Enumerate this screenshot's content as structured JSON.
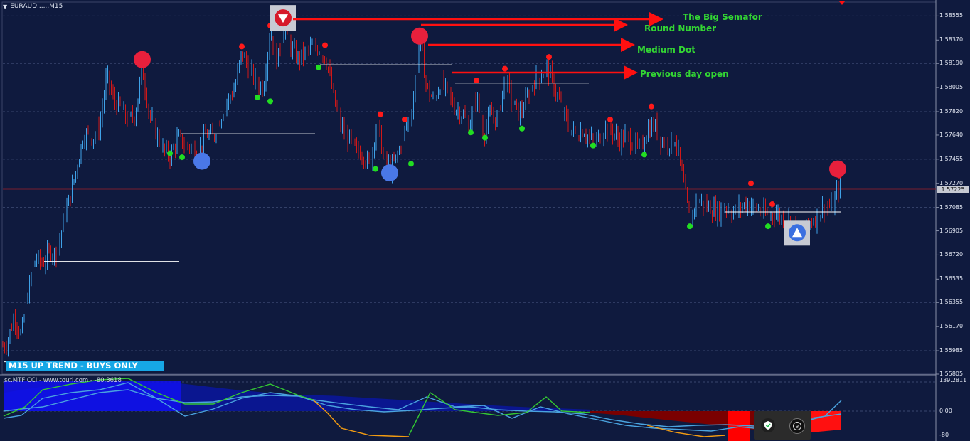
{
  "window": {
    "title": "EURAUD.....,M15"
  },
  "trend_badge": "M15 UP TREND - BUYS ONLY",
  "indicator": {
    "title": "sc.MTF CCI - www.tourl.com - -80.3618",
    "axis_top": "139.2811",
    "axis_mid": "0.00",
    "axis_bottom": "-80"
  },
  "annotations": {
    "big_semafor": "The Big Semafor",
    "round_number": "Round Number",
    "medium_dot": "Medium Dot",
    "previous_day_open": "Previous day open"
  },
  "price_axis": [
    "1.58555",
    "1.58370",
    "1.58190",
    "1.58005",
    "1.57820",
    "1.57640",
    "1.57455",
    "1.57270",
    "1.57085",
    "1.56905",
    "1.56720",
    "1.56535",
    "1.56355",
    "1.56170",
    "1.55985",
    "1.55805"
  ],
  "current_price": "1.57225",
  "colors": {
    "bull": "#3fa2e8",
    "bear": "#d01818",
    "bg": "#0f1a3e",
    "arrow": "#ff1010",
    "annotation": "#33d633",
    "badge": "#16a7e6"
  },
  "chart_data": {
    "type": "candlestick",
    "symbol": "EURAUD",
    "timeframe": "M15",
    "ylim": [
      1.55805,
      1.5865
    ],
    "close_path": [
      [
        0,
        1.56
      ],
      [
        10,
        1.5605
      ],
      [
        20,
        1.5625
      ],
      [
        30,
        1.561
      ],
      [
        40,
        1.5645
      ],
      [
        50,
        1.567
      ],
      [
        60,
        1.5665
      ],
      [
        70,
        1.5675
      ],
      [
        80,
        1.5672
      ],
      [
        90,
        1.57
      ],
      [
        100,
        1.572
      ],
      [
        110,
        1.5745
      ],
      [
        118,
        1.5765
      ],
      [
        130,
        1.5762
      ],
      [
        140,
        1.577
      ],
      [
        150,
        1.581
      ],
      [
        160,
        1.579
      ],
      [
        170,
        1.5785
      ],
      [
        180,
        1.5775
      ],
      [
        190,
        1.578
      ],
      [
        200,
        1.5815
      ],
      [
        210,
        1.578
      ],
      [
        220,
        1.5765
      ],
      [
        230,
        1.5752
      ],
      [
        240,
        1.5748
      ],
      [
        250,
        1.5762
      ],
      [
        260,
        1.5757
      ],
      [
        270,
        1.5755
      ],
      [
        280,
        1.5752
      ],
      [
        290,
        1.5765
      ],
      [
        300,
        1.5762
      ],
      [
        310,
        1.5778
      ],
      [
        320,
        1.579
      ],
      [
        330,
        1.58
      ],
      [
        340,
        1.5828
      ],
      [
        350,
        1.5815
      ],
      [
        360,
        1.5805
      ],
      [
        370,
        1.58
      ],
      [
        380,
        1.5845
      ],
      [
        390,
        1.582
      ],
      [
        400,
        1.585
      ],
      [
        410,
        1.583
      ],
      [
        420,
        1.5822
      ],
      [
        430,
        1.5828
      ],
      [
        440,
        1.5832
      ],
      [
        450,
        1.583
      ],
      [
        460,
        1.582
      ],
      [
        470,
        1.579
      ],
      [
        480,
        1.577
      ],
      [
        490,
        1.5762
      ],
      [
        500,
        1.5752
      ],
      [
        510,
        1.575
      ],
      [
        520,
        1.574
      ],
      [
        530,
        1.5775
      ],
      [
        540,
        1.5745
      ],
      [
        550,
        1.5738
      ],
      [
        560,
        1.575
      ],
      [
        570,
        1.577
      ],
      [
        580,
        1.5785
      ],
      [
        590,
        1.584
      ],
      [
        600,
        1.58
      ],
      [
        610,
        1.579
      ],
      [
        620,
        1.5805
      ],
      [
        630,
        1.5795
      ],
      [
        640,
        1.5785
      ],
      [
        650,
        1.578
      ],
      [
        660,
        1.577
      ],
      [
        670,
        1.5795
      ],
      [
        680,
        1.5765
      ],
      [
        690,
        1.578
      ],
      [
        700,
        1.5775
      ],
      [
        710,
        1.581
      ],
      [
        720,
        1.579
      ],
      [
        730,
        1.578
      ],
      [
        740,
        1.579
      ],
      [
        750,
        1.5805
      ],
      [
        760,
        1.581
      ],
      [
        770,
        1.5815
      ],
      [
        780,
        1.58
      ],
      [
        790,
        1.5785
      ],
      [
        800,
        1.577
      ],
      [
        810,
        1.5765
      ],
      [
        820,
        1.5768
      ],
      [
        830,
        1.576
      ],
      [
        840,
        1.576
      ],
      [
        850,
        1.577
      ],
      [
        860,
        1.5768
      ],
      [
        870,
        1.576
      ],
      [
        880,
        1.5763
      ],
      [
        890,
        1.5758
      ],
      [
        900,
        1.5752
      ],
      [
        910,
        1.5768
      ],
      [
        920,
        1.5772
      ],
      [
        930,
        1.576
      ],
      [
        940,
        1.5758
      ],
      [
        950,
        1.5762
      ],
      [
        960,
        1.573
      ],
      [
        970,
        1.5698
      ],
      [
        980,
        1.5715
      ],
      [
        990,
        1.571
      ],
      [
        1000,
        1.5708
      ],
      [
        1010,
        1.5705
      ],
      [
        1020,
        1.571
      ],
      [
        1030,
        1.5705
      ],
      [
        1040,
        1.5708
      ],
      [
        1050,
        1.5712
      ],
      [
        1060,
        1.571
      ],
      [
        1070,
        1.5705
      ],
      [
        1080,
        1.5702
      ],
      [
        1090,
        1.5705
      ],
      [
        1100,
        1.57
      ],
      [
        1110,
        1.5698
      ],
      [
        1120,
        1.5692
      ],
      [
        1130,
        1.569
      ],
      [
        1140,
        1.5698
      ],
      [
        1150,
        1.5702
      ],
      [
        1160,
        1.571
      ],
      [
        1170,
        1.5708
      ],
      [
        1180,
        1.5725
      ]
    ],
    "pivot_high": [
      [
        200,
        1.5822
      ],
      [
        340,
        1.5832
      ],
      [
        380,
        1.5848
      ],
      [
        457,
        1.5833
      ],
      [
        535,
        1.578
      ],
      [
        569,
        1.5776
      ],
      [
        670,
        1.5806
      ],
      [
        710,
        1.5815
      ],
      [
        772,
        1.5824
      ],
      [
        858,
        1.5776
      ],
      [
        916,
        1.5786
      ],
      [
        1056,
        1.5727
      ],
      [
        1086,
        1.5711
      ],
      [
        1180,
        1.5733
      ]
    ],
    "pivot_low": [
      [
        239,
        1.575
      ],
      [
        256,
        1.5747
      ],
      [
        362,
        1.5793
      ],
      [
        380,
        1.579
      ],
      [
        448,
        1.5816
      ],
      [
        528,
        1.5738
      ],
      [
        578,
        1.5742
      ],
      [
        662,
        1.5766
      ],
      [
        682,
        1.5762
      ],
      [
        734,
        1.5769
      ],
      [
        834,
        1.5756
      ],
      [
        906,
        1.5749
      ],
      [
        970,
        1.5694
      ],
      [
        1080,
        1.5694
      ]
    ],
    "big_dots_high": [
      [
        200,
        1.5822
      ],
      [
        590,
        1.584
      ],
      [
        1178,
        1.5738
      ]
    ],
    "big_dots_low": [
      [
        284,
        1.5744
      ],
      [
        548,
        1.5735
      ]
    ],
    "semafor_boxes": [
      [
        398,
        1.5854,
        "sell"
      ],
      [
        1121,
        1.5689,
        "buy"
      ]
    ],
    "daily_open_lines": [
      [
        5,
        60,
        1.559
      ],
      [
        62,
        252,
        1.5667
      ],
      [
        255,
        443,
        1.5765
      ],
      [
        450,
        635,
        1.5818
      ],
      [
        640,
        828,
        1.5804
      ],
      [
        830,
        1020,
        1.5755
      ],
      [
        1020,
        1182,
        1.5705
      ]
    ],
    "cci_blue_area": [
      [
        5,
        1,
        0.6
      ],
      [
        60,
        1,
        0.8
      ],
      [
        120,
        1,
        0.9
      ],
      [
        190,
        1,
        0.95
      ],
      [
        255,
        1,
        0.9
      ],
      [
        330,
        1,
        0.7
      ],
      [
        400,
        1,
        0.55
      ],
      [
        470,
        1,
        0.5
      ],
      [
        540,
        1,
        0.4
      ],
      [
        610,
        1,
        0.3
      ],
      [
        680,
        1,
        0.2
      ],
      [
        750,
        1,
        0.12
      ],
      [
        830,
        1,
        0.05
      ]
    ],
    "cci_red_area": [
      [
        830,
        1,
        0.05
      ],
      [
        880,
        1,
        0.15
      ],
      [
        940,
        1,
        0.3
      ],
      [
        1000,
        1,
        0.45
      ],
      [
        1025,
        1,
        0.5
      ],
      [
        1055,
        1,
        0.6
      ],
      [
        1100,
        1,
        0.75
      ],
      [
        1150,
        1,
        0.6
      ],
      [
        1183,
        1,
        0.5
      ]
    ],
    "cci_series": [
      {
        "color": "#4aa3df",
        "points": [
          [
            5,
            578
          ],
          [
            30,
            575
          ],
          [
            60,
            572
          ],
          [
            100,
            562
          ],
          [
            140,
            552
          ],
          [
            180,
            548
          ],
          [
            220,
            560
          ],
          [
            260,
            566
          ],
          [
            300,
            565
          ],
          [
            340,
            558
          ],
          [
            380,
            556
          ],
          [
            420,
            557
          ],
          [
            460,
            570
          ],
          [
            500,
            576
          ],
          [
            540,
            579
          ],
          [
            580,
            577
          ],
          [
            620,
            574
          ],
          [
            660,
            572
          ],
          [
            700,
            576
          ],
          [
            740,
            578
          ],
          [
            780,
            579
          ],
          [
            820,
            582
          ],
          [
            860,
            590
          ],
          [
            900,
            596
          ],
          [
            940,
            600
          ],
          [
            980,
            598
          ],
          [
            1020,
            597
          ],
          [
            1060,
            599
          ],
          [
            1100,
            594
          ],
          [
            1140,
            588
          ],
          [
            1183,
            582
          ]
        ]
      },
      {
        "color": "#4aa3df",
        "points": [
          [
            5,
            588
          ],
          [
            30,
            584
          ],
          [
            60,
            560
          ],
          [
            100,
            552
          ],
          [
            140,
            548
          ],
          [
            180,
            538
          ],
          [
            220,
            560
          ],
          [
            260,
            585
          ],
          [
            300,
            575
          ],
          [
            340,
            560
          ],
          [
            380,
            552
          ],
          [
            420,
            557
          ],
          [
            440,
            562
          ],
          [
            470,
            566
          ],
          [
            520,
            572
          ],
          [
            560,
            576
          ],
          [
            600,
            558
          ],
          [
            640,
            572
          ],
          [
            680,
            570
          ],
          [
            720,
            588
          ],
          [
            760,
            572
          ],
          [
            800,
            582
          ],
          [
            840,
            590
          ],
          [
            880,
            598
          ],
          [
            920,
            602
          ],
          [
            960,
            604
          ],
          [
            1000,
            606
          ],
          [
            1040,
            600
          ],
          [
            1080,
            604
          ],
          [
            1120,
            595
          ],
          [
            1160,
            585
          ],
          [
            1183,
            563
          ]
        ]
      },
      {
        "color": "#34c834",
        "points": [
          [
            5,
            585
          ],
          [
            35,
            572
          ],
          [
            60,
            548
          ],
          [
            100,
            540
          ],
          [
            140,
            534
          ],
          [
            180,
            532
          ],
          [
            220,
            552
          ],
          [
            260,
            568
          ],
          [
            300,
            568
          ],
          [
            340,
            552
          ],
          [
            380,
            540
          ],
          [
            420,
            556
          ],
          [
            440,
            562
          ]
        ]
      },
      {
        "color": "#34c834",
        "points": [
          [
            575,
            612
          ],
          [
            605,
            552
          ],
          [
            640,
            576
          ],
          [
            700,
            584
          ],
          [
            740,
            580
          ],
          [
            768,
            558
          ],
          [
            790,
            578
          ],
          [
            830,
            580
          ]
        ]
      },
      {
        "color": "#f39c12",
        "points": [
          [
            440,
            562
          ],
          [
            460,
            580
          ],
          [
            480,
            602
          ],
          [
            520,
            612
          ],
          [
            575,
            614
          ]
        ]
      },
      {
        "color": "#f39c12",
        "points": [
          [
            910,
            598
          ],
          [
            950,
            608
          ],
          [
            990,
            614
          ],
          [
            1020,
            612
          ]
        ]
      }
    ]
  }
}
